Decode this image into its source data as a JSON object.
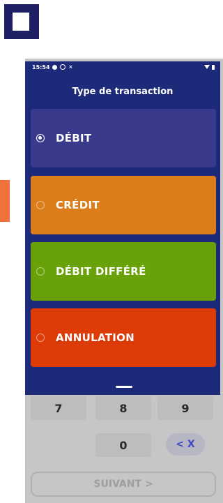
{
  "status_bar": {
    "time": "15:54",
    "icons": [
      "notification-dot-icon",
      "check-circle-icon",
      "nfc-icon",
      "wifi-icon",
      "battery-icon"
    ],
    "x_glyph": "×"
  },
  "dialog": {
    "title": "Type de transaction",
    "options": [
      {
        "label": "DÉBIT",
        "selected": true,
        "color": "#3a3a8c"
      },
      {
        "label": "CRÉDIT",
        "selected": false,
        "color": "#dc7d1c"
      },
      {
        "label": "DÉBIT DIFFÉRÉ",
        "selected": false,
        "color": "#68a10a"
      },
      {
        "label": "ANNULATION",
        "selected": false,
        "color": "#dd3b08"
      }
    ]
  },
  "keypad": {
    "row1": [
      "7",
      "8",
      "9"
    ],
    "row2": [
      "0"
    ],
    "backspace_label": "< X"
  },
  "next_button": {
    "label": "SUIVANT >"
  },
  "colors": {
    "brand_navy": "#1c2a79",
    "accent_orange": "#f0713b"
  }
}
